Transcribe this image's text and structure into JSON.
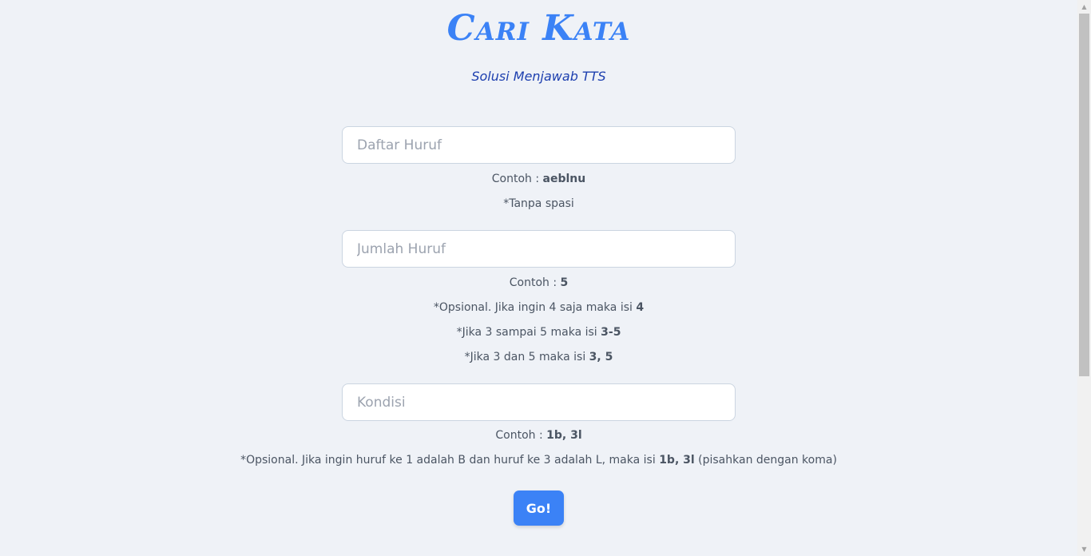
{
  "header": {
    "title": "Cari Kata",
    "subtitle": "Solusi Menjawab TTS"
  },
  "form": {
    "letters": {
      "placeholder": "Daftar Huruf",
      "value": "",
      "example_prefix": "Contoh : ",
      "example_value": "aeblnu",
      "notes": [
        "*Tanpa spasi"
      ]
    },
    "length": {
      "placeholder": "Jumlah Huruf",
      "value": "",
      "example_prefix": "Contoh : ",
      "example_value": "5",
      "note1_text": "*Opsional. Jika ingin 4 saja maka isi ",
      "note1_bold": "4",
      "note2_text": "*Jika 3 sampai 5 maka isi ",
      "note2_bold": "3-5",
      "note3_text": "*Jika 3 dan 5 maka isi ",
      "note3_bold": "3, 5"
    },
    "condition": {
      "placeholder": "Kondisi",
      "value": "",
      "example_prefix": "Contoh : ",
      "example_value": "1b, 3l",
      "note_text": "*Opsional. Jika ingin huruf ke 1 adalah B dan huruf ke 3 adalah L, maka isi ",
      "note_bold": "1b, 3l",
      "note_suffix": " (pisahkan dengan koma)"
    },
    "submit_label": "Go!"
  },
  "colors": {
    "background": "#eff2f7",
    "accent": "#3b82f6",
    "subtitle": "#1e40af"
  }
}
